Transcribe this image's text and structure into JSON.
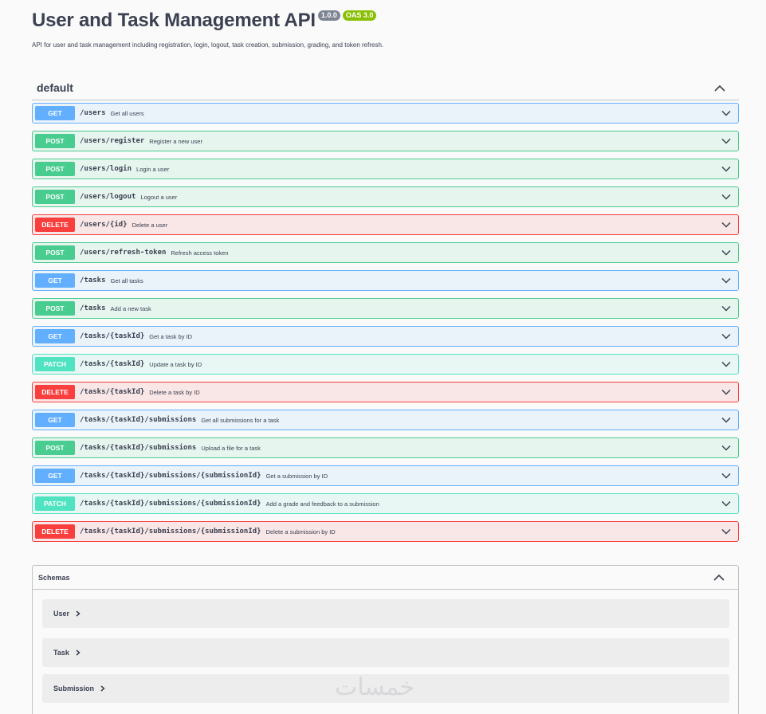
{
  "info": {
    "title": "User and Task Management API",
    "version_badge": "1.0.0",
    "oas_badge": "OAS 3.0",
    "description": "API for user and task management including registration, login, logout, task creation, submission, grading, and token refresh."
  },
  "tag": {
    "name": "default",
    "expanded_icon": "chevron-up-icon"
  },
  "operations": [
    {
      "method": "GET",
      "path": "/users",
      "summary": "Get all users"
    },
    {
      "method": "POST",
      "path": "/users/register",
      "summary": "Register a new user"
    },
    {
      "method": "POST",
      "path": "/users/login",
      "summary": "Login a user"
    },
    {
      "method": "POST",
      "path": "/users/logout",
      "summary": "Logout a user"
    },
    {
      "method": "DELETE",
      "path": "/users/{id}",
      "summary": "Delete a user"
    },
    {
      "method": "POST",
      "path": "/users/refresh-token",
      "summary": "Refresh access token"
    },
    {
      "method": "GET",
      "path": "/tasks",
      "summary": "Get all tasks"
    },
    {
      "method": "POST",
      "path": "/tasks",
      "summary": "Add a new task"
    },
    {
      "method": "GET",
      "path": "/tasks/{taskId}",
      "summary": "Get a task by ID"
    },
    {
      "method": "PATCH",
      "path": "/tasks/{taskId}",
      "summary": "Update a task by ID"
    },
    {
      "method": "DELETE",
      "path": "/tasks/{taskId}",
      "summary": "Delete a task by ID"
    },
    {
      "method": "GET",
      "path": "/tasks/{taskId}/submissions",
      "summary": "Get all submissions for a task"
    },
    {
      "method": "POST",
      "path": "/tasks/{taskId}/submissions",
      "summary": "Upload a file for a task"
    },
    {
      "method": "GET",
      "path": "/tasks/{taskId}/submissions/{submissionId}",
      "summary": "Get a submission by ID"
    },
    {
      "method": "PATCH",
      "path": "/tasks/{taskId}/submissions/{submissionId}",
      "summary": "Add a grade and feedback to a submission"
    },
    {
      "method": "DELETE",
      "path": "/tasks/{taskId}/submissions/{submissionId}",
      "summary": "Delete a submission by ID"
    }
  ],
  "schemas": {
    "title": "Schemas",
    "items": [
      "User",
      "Task",
      "Submission"
    ]
  },
  "watermark": "خمسات",
  "colors": {
    "get": "#61affe",
    "post": "#49cc90",
    "delete": "#f93e3e",
    "patch": "#50e3c2"
  }
}
